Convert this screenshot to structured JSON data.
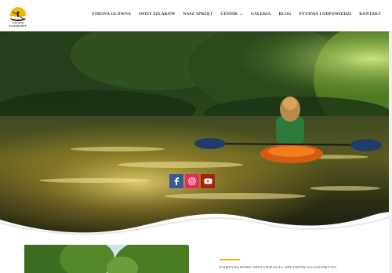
{
  "brand": {
    "logo_text": "ZAJAZD KAJAKOWY",
    "logo_icon": "kayak-sun-logo",
    "colors": {
      "sun": "#f2b705",
      "accent": "#f2b705"
    }
  },
  "nav": {
    "items": [
      {
        "label": "STRONA GŁÓWNA"
      },
      {
        "label": "OPISY SZLAKÓW"
      },
      {
        "label": "NASZ SPRZĘT"
      },
      {
        "label": "CENNIK",
        "dropdown": true
      },
      {
        "label": "GALERIA"
      },
      {
        "label": "BLOG"
      },
      {
        "label": "PYTANIA I ODPOWIEDZI"
      },
      {
        "label": "KONTAKT"
      }
    ]
  },
  "social": {
    "facebook": {
      "icon": "facebook-icon",
      "color": "#3b5998"
    },
    "instagram": {
      "icon": "instagram-icon",
      "color": "#ea2c59"
    },
    "youtube": {
      "icon": "youtube-icon",
      "color": "#a82400"
    }
  },
  "section": {
    "tagline": "KOMPLEKSOWA ORGANIZACJA SPŁYWÓW KAJAKOWYCH"
  }
}
